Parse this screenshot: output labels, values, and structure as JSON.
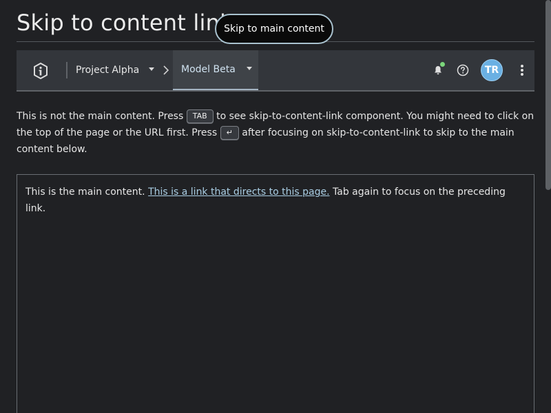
{
  "page": {
    "title": "Skip to content link"
  },
  "skip_link": {
    "label": "Skip to main content"
  },
  "header": {
    "breadcrumb": {
      "project": "Project Alpha",
      "model": "Model Beta"
    },
    "avatar_initials": "TR",
    "icons": {
      "logo": "info-logo-icon",
      "chevron": "chevron-right-icon",
      "notifications": "bell-icon",
      "notification_status_color": "#7bd67b",
      "help": "question-circle-icon",
      "more": "kebab-menu-icon"
    },
    "colors": {
      "bar": "#33363b",
      "avatar": "#6ab0e3",
      "active_tab_underline": "#a6b6c4"
    }
  },
  "intro": {
    "text_1": "This is not the main content. Press ",
    "key_tab": "TAB",
    "text_2": " to see skip-to-content-link component. You might need to click on the top of the page or the URL first. Press ",
    "key_enter": "↵",
    "text_3": " after focusing on skip-to-content-link to skip to the main content below."
  },
  "main": {
    "text_before": "This is the main content. ",
    "link_label": "This is a link that directs to this page.",
    "text_after": " Tab again to focus on the preceding link."
  }
}
